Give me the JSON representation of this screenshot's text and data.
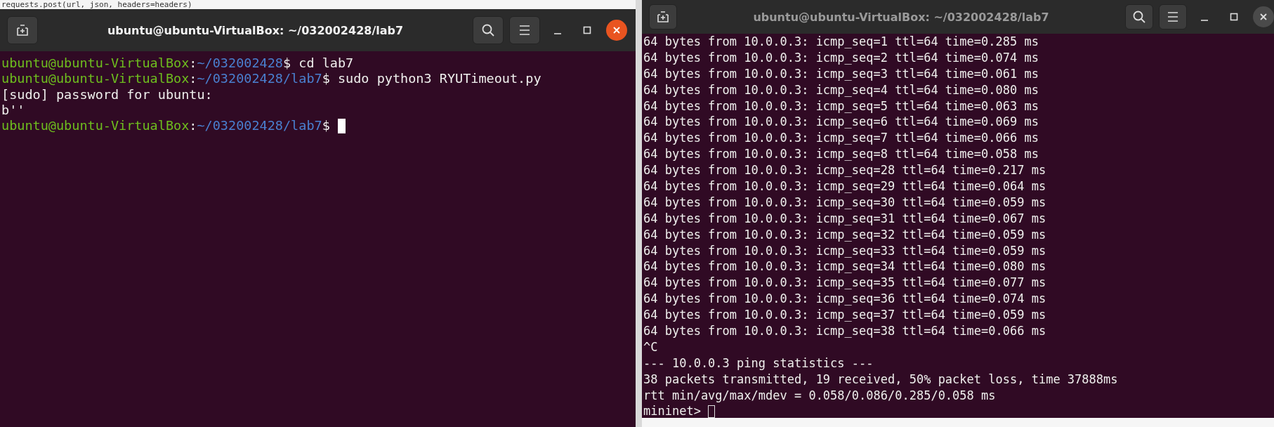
{
  "background_editor": {
    "text": "requests.post(url, json, headers=headers)"
  },
  "windows": [
    {
      "title": "ubuntu@ubuntu-VirtualBox: ~/032002428/lab7",
      "focused": true,
      "lines": [
        {
          "kind": "prompt",
          "user": "ubuntu@ubuntu-VirtualBox",
          "separator": ":",
          "path": "~/032002428",
          "command": "$ cd lab7"
        },
        {
          "kind": "prompt",
          "user": "ubuntu@ubuntu-VirtualBox",
          "separator": ":",
          "path": "~/032002428/lab7",
          "command": "$ sudo python3 RYUTimeout.py"
        },
        {
          "kind": "output",
          "text": "[sudo] password for ubuntu:"
        },
        {
          "kind": "output",
          "text": "b''"
        },
        {
          "kind": "prompt",
          "user": "ubuntu@ubuntu-VirtualBox",
          "separator": ":",
          "path": "~/032002428/lab7",
          "command": "$",
          "cursor": true
        }
      ]
    },
    {
      "title": "ubuntu@ubuntu-VirtualBox: ~/032002428/lab7",
      "focused": false,
      "lines": [
        {
          "kind": "output",
          "text": "64 bytes from 10.0.0.3: icmp_seq=1 ttl=64 time=0.285 ms"
        },
        {
          "kind": "output",
          "text": "64 bytes from 10.0.0.3: icmp_seq=2 ttl=64 time=0.074 ms"
        },
        {
          "kind": "output",
          "text": "64 bytes from 10.0.0.3: icmp_seq=3 ttl=64 time=0.061 ms"
        },
        {
          "kind": "output",
          "text": "64 bytes from 10.0.0.3: icmp_seq=4 ttl=64 time=0.080 ms"
        },
        {
          "kind": "output",
          "text": "64 bytes from 10.0.0.3: icmp_seq=5 ttl=64 time=0.063 ms"
        },
        {
          "kind": "output",
          "text": "64 bytes from 10.0.0.3: icmp_seq=6 ttl=64 time=0.069 ms"
        },
        {
          "kind": "output",
          "text": "64 bytes from 10.0.0.3: icmp_seq=7 ttl=64 time=0.066 ms"
        },
        {
          "kind": "output",
          "text": "64 bytes from 10.0.0.3: icmp_seq=8 ttl=64 time=0.058 ms"
        },
        {
          "kind": "output",
          "text": "64 bytes from 10.0.0.3: icmp_seq=28 ttl=64 time=0.217 ms"
        },
        {
          "kind": "output",
          "text": "64 bytes from 10.0.0.3: icmp_seq=29 ttl=64 time=0.064 ms"
        },
        {
          "kind": "output",
          "text": "64 bytes from 10.0.0.3: icmp_seq=30 ttl=64 time=0.059 ms"
        },
        {
          "kind": "output",
          "text": "64 bytes from 10.0.0.3: icmp_seq=31 ttl=64 time=0.067 ms"
        },
        {
          "kind": "output",
          "text": "64 bytes from 10.0.0.3: icmp_seq=32 ttl=64 time=0.059 ms"
        },
        {
          "kind": "output",
          "text": "64 bytes from 10.0.0.3: icmp_seq=33 ttl=64 time=0.059 ms"
        },
        {
          "kind": "output",
          "text": "64 bytes from 10.0.0.3: icmp_seq=34 ttl=64 time=0.080 ms"
        },
        {
          "kind": "output",
          "text": "64 bytes from 10.0.0.3: icmp_seq=35 ttl=64 time=0.077 ms"
        },
        {
          "kind": "output",
          "text": "64 bytes from 10.0.0.3: icmp_seq=36 ttl=64 time=0.074 ms"
        },
        {
          "kind": "output",
          "text": "64 bytes from 10.0.0.3: icmp_seq=37 ttl=64 time=0.059 ms"
        },
        {
          "kind": "output",
          "text": "64 bytes from 10.0.0.3: icmp_seq=38 ttl=64 time=0.066 ms"
        },
        {
          "kind": "output",
          "text": "^C"
        },
        {
          "kind": "output",
          "text": "--- 10.0.0.3 ping statistics ---"
        },
        {
          "kind": "output",
          "text": "38 packets transmitted, 19 received, 50% packet loss, time 37888ms"
        },
        {
          "kind": "output",
          "text": "rtt min/avg/max/mdev = 0.058/0.086/0.285/0.058 ms"
        },
        {
          "kind": "output",
          "text": "mininet>",
          "cursor": true
        }
      ]
    }
  ]
}
